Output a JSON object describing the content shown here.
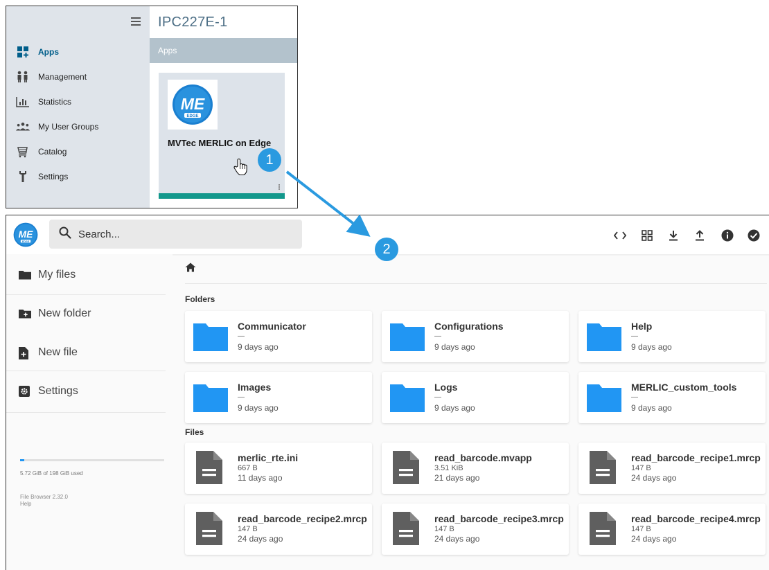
{
  "ied": {
    "title": "IPC227E-1",
    "subbar": "Apps",
    "nav": [
      {
        "label": "Apps",
        "icon": "apps-grid-icon"
      },
      {
        "label": "Management",
        "icon": "management-people-icon"
      },
      {
        "label": "Statistics",
        "icon": "statistics-chart-icon"
      },
      {
        "label": "My User Groups",
        "icon": "user-groups-icon"
      },
      {
        "label": "Catalog",
        "icon": "catalog-cart-icon"
      },
      {
        "label": "Settings",
        "icon": "settings-wrench-icon"
      }
    ],
    "app_tile": {
      "name": "MVTec MERLIC on Edge"
    }
  },
  "callouts": {
    "step1": "1",
    "step2": "2"
  },
  "filebrowser": {
    "search_placeholder": "Search...",
    "header_actions": [
      "code-toggle-icon",
      "grid-view-icon",
      "download-icon",
      "upload-icon",
      "info-icon",
      "select-check-icon"
    ],
    "sidebar": {
      "my_files": "My files",
      "new_folder": "New folder",
      "new_file": "New file",
      "settings": "Settings",
      "usage_text": "5.72 GiB of 198 GiB used",
      "usage_fraction": 0.029,
      "version": "File Browser 2.32.0",
      "help": "Help"
    },
    "sections": {
      "folders": "Folders",
      "files": "Files"
    },
    "folders": [
      {
        "name": "Communicator",
        "size": "—",
        "modified": "9 days ago"
      },
      {
        "name": "Configurations",
        "size": "—",
        "modified": "9 days ago"
      },
      {
        "name": "Help",
        "size": "—",
        "modified": "9 days ago"
      },
      {
        "name": "Images",
        "size": "—",
        "modified": "9 days ago"
      },
      {
        "name": "Logs",
        "size": "—",
        "modified": "9 days ago"
      },
      {
        "name": "MERLIC_custom_tools",
        "size": "—",
        "modified": "9 days ago"
      }
    ],
    "files": [
      {
        "name": "merlic_rte.ini",
        "size": "667 B",
        "modified": "11 days ago"
      },
      {
        "name": "read_barcode.mvapp",
        "size": "3.51 KiB",
        "modified": "21 days ago"
      },
      {
        "name": "read_barcode_recipe1.mrcp",
        "size": "147 B",
        "modified": "24 days ago"
      },
      {
        "name": "read_barcode_recipe2.mrcp",
        "size": "147 B",
        "modified": "24 days ago"
      },
      {
        "name": "read_barcode_recipe3.mrcp",
        "size": "147 B",
        "modified": "24 days ago"
      },
      {
        "name": "read_barcode_recipe4.mrcp",
        "size": "147 B",
        "modified": "24 days ago"
      }
    ]
  },
  "colors": {
    "ied_sidebar": "#dfe4ea",
    "ied_active": "#005e8a",
    "tile_bar": "#12988c",
    "folder_blue": "#2196f3",
    "callout_blue": "#2a9ae0",
    "merlic_logo_blue": "#1a7fd0"
  }
}
